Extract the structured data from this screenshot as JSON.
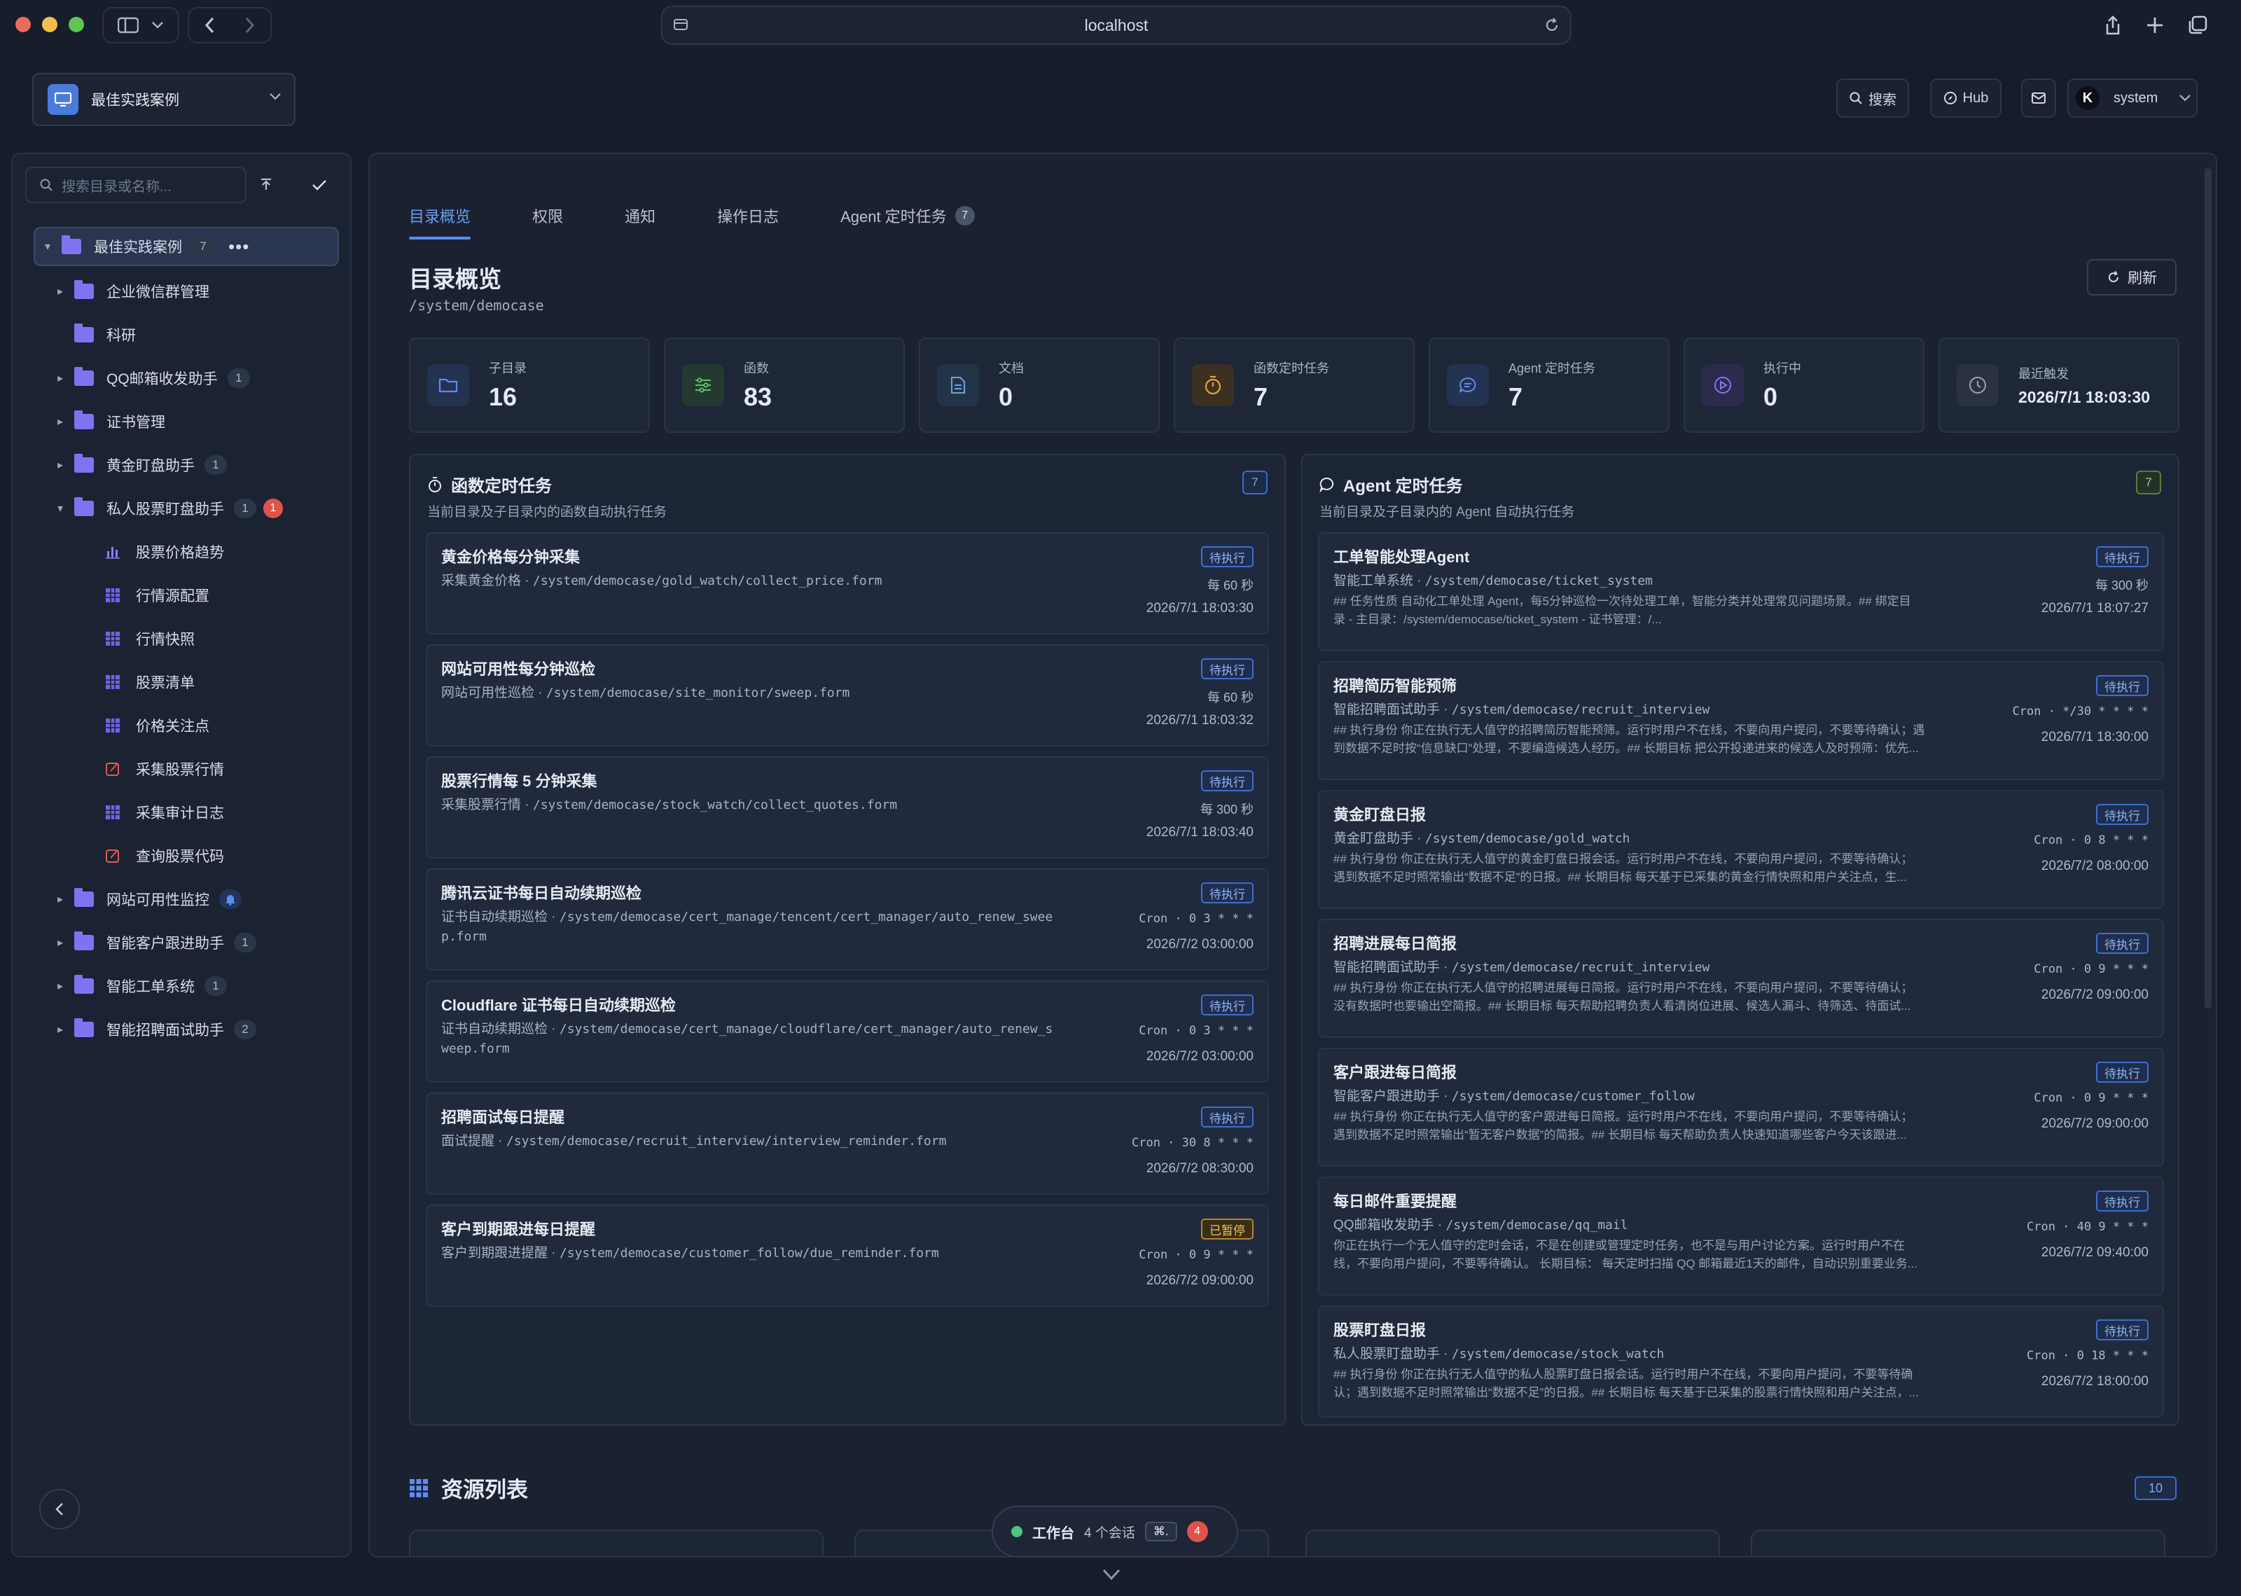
{
  "browser": {
    "url": "localhost"
  },
  "header": {
    "space_name": "最佳实践案例",
    "search_label": "搜索",
    "hub_label": "Hub",
    "user_name": "system",
    "avatar_letter": "K"
  },
  "sidebar": {
    "search_placeholder": "搜索目录或名称...",
    "root": {
      "label": "最佳实践案例",
      "count": "7"
    },
    "items": [
      {
        "label": "企业微信群管理"
      },
      {
        "label": "科研"
      },
      {
        "label": "QQ邮箱收发助手",
        "count": "1"
      },
      {
        "label": "证书管理"
      },
      {
        "label": "黄金盯盘助手",
        "count": "1"
      },
      {
        "label": "私人股票盯盘助手",
        "count": "1",
        "alert": "1"
      },
      {
        "label": "股票价格趋势",
        "icon": "bar-chart-icon"
      },
      {
        "label": "行情源配置",
        "icon": "table-icon"
      },
      {
        "label": "行情快照",
        "icon": "table-icon"
      },
      {
        "label": "股票清单",
        "icon": "table-icon"
      },
      {
        "label": "价格关注点",
        "icon": "table-icon"
      },
      {
        "label": "采集股票行情",
        "icon": "form-icon"
      },
      {
        "label": "采集审计日志",
        "icon": "table-icon"
      },
      {
        "label": "查询股票代码",
        "icon": "form-icon"
      },
      {
        "label": "网站可用性监控"
      },
      {
        "label": "智能客户跟进助手",
        "count": "1"
      },
      {
        "label": "智能工单系统",
        "count": "1"
      },
      {
        "label": "智能招聘面试助手",
        "count": "2"
      }
    ]
  },
  "tabs": [
    {
      "label": "目录概览"
    },
    {
      "label": "权限"
    },
    {
      "label": "通知"
    },
    {
      "label": "操作日志"
    },
    {
      "label": "Agent 定时任务",
      "badge": "7"
    }
  ],
  "page": {
    "title": "目录概览",
    "path": "/system/democase",
    "refresh_label": "刷新"
  },
  "stats": [
    {
      "label": "子目录",
      "value": "16",
      "icon": "folder-icon",
      "color": "#5b8def"
    },
    {
      "label": "函数",
      "value": "83",
      "icon": "sliders-icon",
      "color": "#5fbf72"
    },
    {
      "label": "文档",
      "value": "0",
      "icon": "document-icon",
      "color": "#6fa0d8"
    },
    {
      "label": "函数定时任务",
      "value": "7",
      "icon": "timer-icon",
      "color": "#e7a33c"
    },
    {
      "label": "Agent 定时任务",
      "value": "7",
      "icon": "chat-icon",
      "color": "#5b8def"
    },
    {
      "label": "执行中",
      "value": "0",
      "icon": "play-icon",
      "color": "#8a74f0"
    },
    {
      "label": "最近触发",
      "value": "2026/7/1 18:03:30",
      "icon": "clock-icon",
      "color": "#9aa4b6"
    }
  ],
  "func_panel": {
    "title": "函数定时任务",
    "subtitle": "当前目录及子目录内的函数自动执行任务",
    "count": "7",
    "tasks": [
      {
        "name": "黄金价格每分钟采集",
        "owner": "采集黄金价格",
        "path": "/system/democase/gold_watch/collect_price.form",
        "status": "待执行",
        "schedule": "每 60 秒",
        "time": "2026/7/1 18:03:30"
      },
      {
        "name": "网站可用性每分钟巡检",
        "owner": "网站可用性巡检",
        "path": "/system/democase/site_monitor/sweep.form",
        "status": "待执行",
        "schedule": "每 60 秒",
        "time": "2026/7/1 18:03:32"
      },
      {
        "name": "股票行情每 5 分钟采集",
        "owner": "采集股票行情",
        "path": "/system/democase/stock_watch/collect_quotes.form",
        "status": "待执行",
        "schedule": "每 300 秒",
        "time": "2026/7/1 18:03:40"
      },
      {
        "name": "腾讯云证书每日自动续期巡检",
        "owner": "证书自动续期巡检",
        "path": "/system/democase/cert_manage/tencent/cert_manager/auto_renew_swee",
        "path2": "p.form",
        "status": "待执行",
        "schedule": "Cron · 0 3 * * *",
        "time": "2026/7/2 03:00:00"
      },
      {
        "name": "Cloudflare 证书每日自动续期巡检",
        "owner": "证书自动续期巡检",
        "path": "/system/democase/cert_manage/cloudflare/cert_manager/auto_renew_s",
        "path2": "weep.form",
        "status": "待执行",
        "schedule": "Cron · 0 3 * * *",
        "time": "2026/7/2 03:00:00"
      },
      {
        "name": "招聘面试每日提醒",
        "owner": "面试提醒",
        "path": "/system/democase/recruit_interview/interview_reminder.form",
        "status": "待执行",
        "schedule": "Cron · 30 8 * * *",
        "time": "2026/7/2 08:30:00"
      },
      {
        "name": "客户到期跟进每日提醒",
        "owner": "客户到期跟进提醒",
        "path": "/system/democase/customer_follow/due_reminder.form",
        "status": "已暂停",
        "schedule": "Cron · 0 9 * * *",
        "time": "2026/7/2 09:00:00"
      }
    ]
  },
  "agent_panel": {
    "title": "Agent 定时任务",
    "subtitle": "当前目录及子目录内的 Agent 自动执行任务",
    "count": "7",
    "tasks": [
      {
        "name": "工单智能处理Agent",
        "owner": "智能工单系统",
        "path": "/system/democase/ticket_system",
        "status": "待执行",
        "schedule": "每 300 秒",
        "time": "2026/7/1 18:07:27",
        "body1": "## 任务性质 自动化工单处理 Agent，每5分钟巡检一次待处理工单，智能分类并处理常见问题场景。## 绑定目",
        "body2": "录 - 主目录：/system/democase/ticket_system - 证书管理：/..."
      },
      {
        "name": "招聘简历智能预筛",
        "owner": "智能招聘面试助手",
        "path": "/system/democase/recruit_interview",
        "status": "待执行",
        "schedule": "Cron · */30 * * * *",
        "time": "2026/7/1 18:30:00",
        "body1": "## 执行身份 你正在执行无人值守的招聘简历智能预筛。运行时用户不在线，不要向用户提问，不要等待确认；遇",
        "body2": "到数据不足时按“信息缺口”处理，不要编造候选人经历。## 长期目标 把公开投递进来的候选人及时预筛：优先..."
      },
      {
        "name": "黄金盯盘日报",
        "owner": "黄金盯盘助手",
        "path": "/system/democase/gold_watch",
        "status": "待执行",
        "schedule": "Cron · 0 8 * * *",
        "time": "2026/7/2 08:00:00",
        "body1": "## 执行身份 你正在执行无人值守的黄金盯盘日报会话。运行时用户不在线，不要向用户提问，不要等待确认；",
        "body2": "遇到数据不足时照常输出“数据不足”的日报。## 长期目标 每天基于已采集的黄金行情快照和用户关注点，生..."
      },
      {
        "name": "招聘进展每日简报",
        "owner": "智能招聘面试助手",
        "path": "/system/democase/recruit_interview",
        "status": "待执行",
        "schedule": "Cron · 0 9 * * *",
        "time": "2026/7/2 09:00:00",
        "body1": "## 执行身份 你正在执行无人值守的招聘进展每日简报。运行时用户不在线，不要向用户提问，不要等待确认；",
        "body2": "没有数据时也要输出空简报。## 长期目标 每天帮助招聘负责人看清岗位进展、候选人漏斗、待筛选、待面试..."
      },
      {
        "name": "客户跟进每日简报",
        "owner": "智能客户跟进助手",
        "path": "/system/democase/customer_follow",
        "status": "待执行",
        "schedule": "Cron · 0 9 * * *",
        "time": "2026/7/2 09:00:00",
        "body1": "## 执行身份 你正在执行无人值守的客户跟进每日简报。运行时用户不在线，不要向用户提问，不要等待确认；",
        "body2": "遇到数据不足时照常输出“暂无客户数据”的简报。## 长期目标 每天帮助负责人快速知道哪些客户今天该跟进..."
      },
      {
        "name": "每日邮件重要提醒",
        "owner": "QQ邮箱收发助手",
        "path": "/system/democase/qq_mail",
        "status": "待执行",
        "schedule": "Cron · 40 9 * * *",
        "time": "2026/7/2 09:40:00",
        "body1": "你正在执行一个无人值守的定时会话，不是在创建或管理定时任务，也不是与用户讨论方案。运行时用户不在",
        "body2": "线，不要向用户提问，不要等待确认。 长期目标： 每天定时扫描 QQ 邮箱最近1天的邮件，自动识别重要业务..."
      },
      {
        "name": "股票盯盘日报",
        "owner": "私人股票盯盘助手",
        "path": "/system/democase/stock_watch",
        "status": "待执行",
        "schedule": "Cron · 0 18 * * *",
        "time": "2026/7/2 18:00:00",
        "body1": "## 执行身份 你正在执行无人值守的私人股票盯盘日报会话。运行时用户不在线，不要向用户提问，不要等待确",
        "body2": "认；遇到数据不足时照常输出“数据不足”的日报。## 长期目标 每天基于已采集的股票行情快照和用户关注点，..."
      }
    ]
  },
  "resources": {
    "title": "资源列表",
    "count": "10"
  },
  "dock": {
    "label": "工作台",
    "sessions": "4 个会话",
    "shortcut": "⌘.",
    "badge": "4"
  }
}
